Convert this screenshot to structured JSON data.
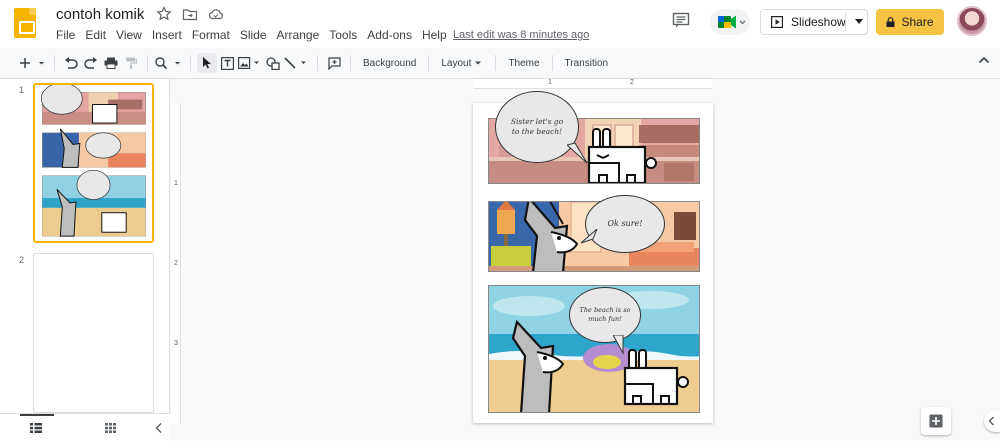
{
  "header": {
    "doc_title": "contoh komik",
    "menu": [
      "File",
      "Edit",
      "View",
      "Insert",
      "Format",
      "Slide",
      "Arrange",
      "Tools",
      "Add-ons",
      "Help"
    ],
    "last_edit": "Last edit was 8 minutes ago",
    "slideshow_label": "Slideshow",
    "share_label": "Share"
  },
  "toolbar": {
    "background_label": "Background",
    "layout_label": "Layout",
    "theme_label": "Theme",
    "transition_label": "Transition"
  },
  "filmstrip": {
    "slides": [
      {
        "number": "1"
      },
      {
        "number": "2"
      }
    ]
  },
  "rulers": {
    "horizontal": [
      "1",
      "2"
    ],
    "vertical": [
      "1",
      "2",
      "3"
    ]
  },
  "slide": {
    "panel1_text": "Sister let's go to the beach!",
    "panel2_text": "Ok sure!",
    "panel3_text": "The beach is so much fun!"
  },
  "colors": {
    "accent": "#f4b400",
    "share": "#f5c243",
    "link": "#5f6368"
  }
}
